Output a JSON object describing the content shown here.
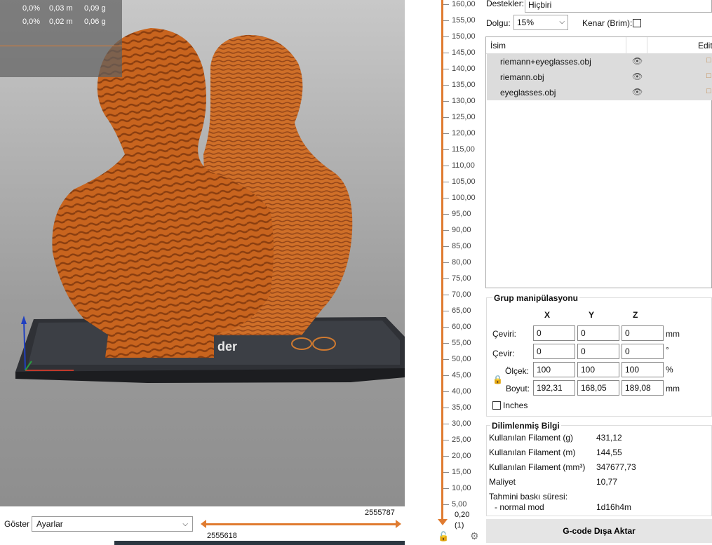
{
  "legend": {
    "rows": [
      {
        "pct": "0,0%",
        "len": "0,03 m",
        "wt": "0,09 g"
      },
      {
        "pct": "0,0%",
        "len": "0,02 m",
        "wt": "0,06 g"
      }
    ]
  },
  "viewport_bottom": {
    "show_label": "Göster",
    "show_value": "Ayarlar",
    "slider_top": "2555787",
    "slider_bottom": "2555618"
  },
  "vertical_slider": {
    "ticks": [
      "160,00",
      "155,00",
      "150,00",
      "145,00",
      "140,00",
      "135,00",
      "130,00",
      "125,00",
      "120,00",
      "115,00",
      "110,00",
      "105,00",
      "100,00",
      "95,00",
      "90,00",
      "85,00",
      "80,00",
      "75,00",
      "70,00",
      "65,00",
      "60,00",
      "55,00",
      "50,00",
      "45,00",
      "40,00",
      "35,00",
      "30,00",
      "25,00",
      "20,00",
      "15,00",
      "10,00",
      "5,00"
    ],
    "min": "0,20",
    "count": "(1)"
  },
  "settings": {
    "supports_label": "Destekler:",
    "supports_value": "Hiçbiri",
    "fill_label": "Dolgu:",
    "fill_value": "15%",
    "brim_label": "Kenar (Brim):"
  },
  "object_list": {
    "col_name": "İsim",
    "col_edit": "Edit",
    "items": [
      {
        "name": "riemann+eyeglasses.obj"
      },
      {
        "name": "riemann.obj"
      },
      {
        "name": "eyeglasses.obj"
      }
    ]
  },
  "group_manip": {
    "title": "Grup manipülasyonu",
    "axes": [
      "X",
      "Y",
      "Z"
    ],
    "rows": [
      {
        "label": "Çeviri:",
        "values": [
          "0",
          "0",
          "0"
        ],
        "unit": "mm"
      },
      {
        "label": "Çevir:",
        "values": [
          "0",
          "0",
          "0"
        ],
        "unit": "°"
      },
      {
        "label": "Ölçek:",
        "values": [
          "100",
          "100",
          "100"
        ],
        "unit": "%"
      },
      {
        "label": "Boyut:",
        "values": [
          "192,31",
          "168,05",
          "189,08"
        ],
        "unit": "mm"
      }
    ],
    "inches_label": "Inches"
  },
  "sliced_info": {
    "title": "Dilimlenmiş Bilgi",
    "rows": [
      {
        "label": "Kullanılan Filament (g)",
        "value": "431,12"
      },
      {
        "label": "Kullanılan Filament (m)",
        "value": "144,55"
      },
      {
        "label": "Kullanılan Filament (mm³)",
        "value": "347677,73"
      },
      {
        "label": "Maliyet",
        "value": "10,77"
      }
    ],
    "time_title": "Tahmini baskı süresi:",
    "time_mode": "- normal mod",
    "time_value": "1d16h4m"
  },
  "export_button": "G-code Dışa Aktar",
  "colors": {
    "accent": "#e07b30",
    "model": "#c8641e"
  }
}
